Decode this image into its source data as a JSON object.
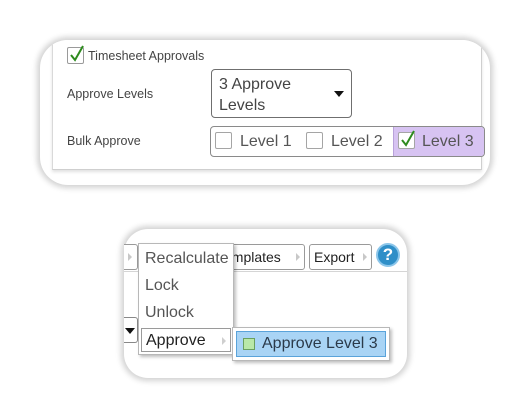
{
  "settings": {
    "timesheet_approvals": {
      "label": "Timesheet Approvals",
      "checked": true
    },
    "approve_levels": {
      "label": "Approve Levels",
      "selected": "3 Approve Levels"
    },
    "bulk_approve": {
      "label": "Bulk Approve",
      "levels": [
        {
          "label": "Level 1",
          "checked": false
        },
        {
          "label": "Level 2",
          "checked": false
        },
        {
          "label": "Level 3",
          "checked": true
        }
      ]
    }
  },
  "toolbar": {
    "templates_label": "emplates",
    "export_label": "Export",
    "help_label": "?"
  },
  "context_menu": {
    "items": [
      {
        "label": "Recalculate"
      },
      {
        "label": "Lock"
      },
      {
        "label": "Unlock"
      },
      {
        "label": "Approve",
        "has_submenu": true
      }
    ],
    "submenu": {
      "items": [
        {
          "label": "Approve Level 3"
        }
      ]
    }
  },
  "colors": {
    "selected_level_bg": "#d7c3f2",
    "submenu_highlight": "#a9d4f5",
    "help_icon": "#2f8fc8",
    "check_green": "#2e8b1e"
  }
}
